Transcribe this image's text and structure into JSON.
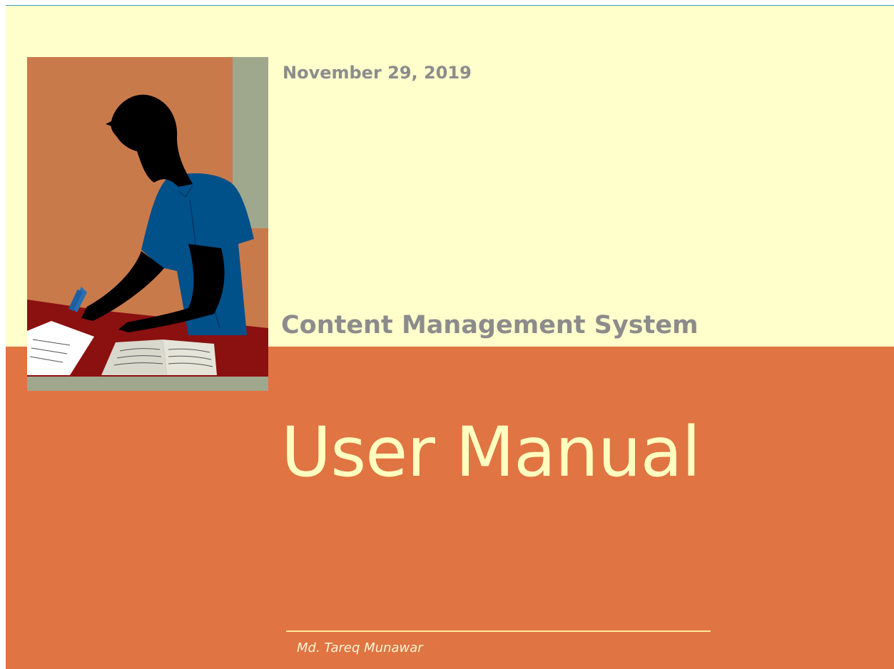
{
  "document": {
    "date": "November 29, 2019",
    "subtitle": "Content Management System",
    "title": "User Manual",
    "author": "Md. Tareq Munawar"
  },
  "colors": {
    "top_background": "#ffffcc",
    "bottom_background": "#e07443",
    "heading_gray": "#8c8c8c",
    "title_cream": "#ffffc0"
  },
  "illustration": {
    "icon": "person-writing-at-desk-clipart"
  }
}
